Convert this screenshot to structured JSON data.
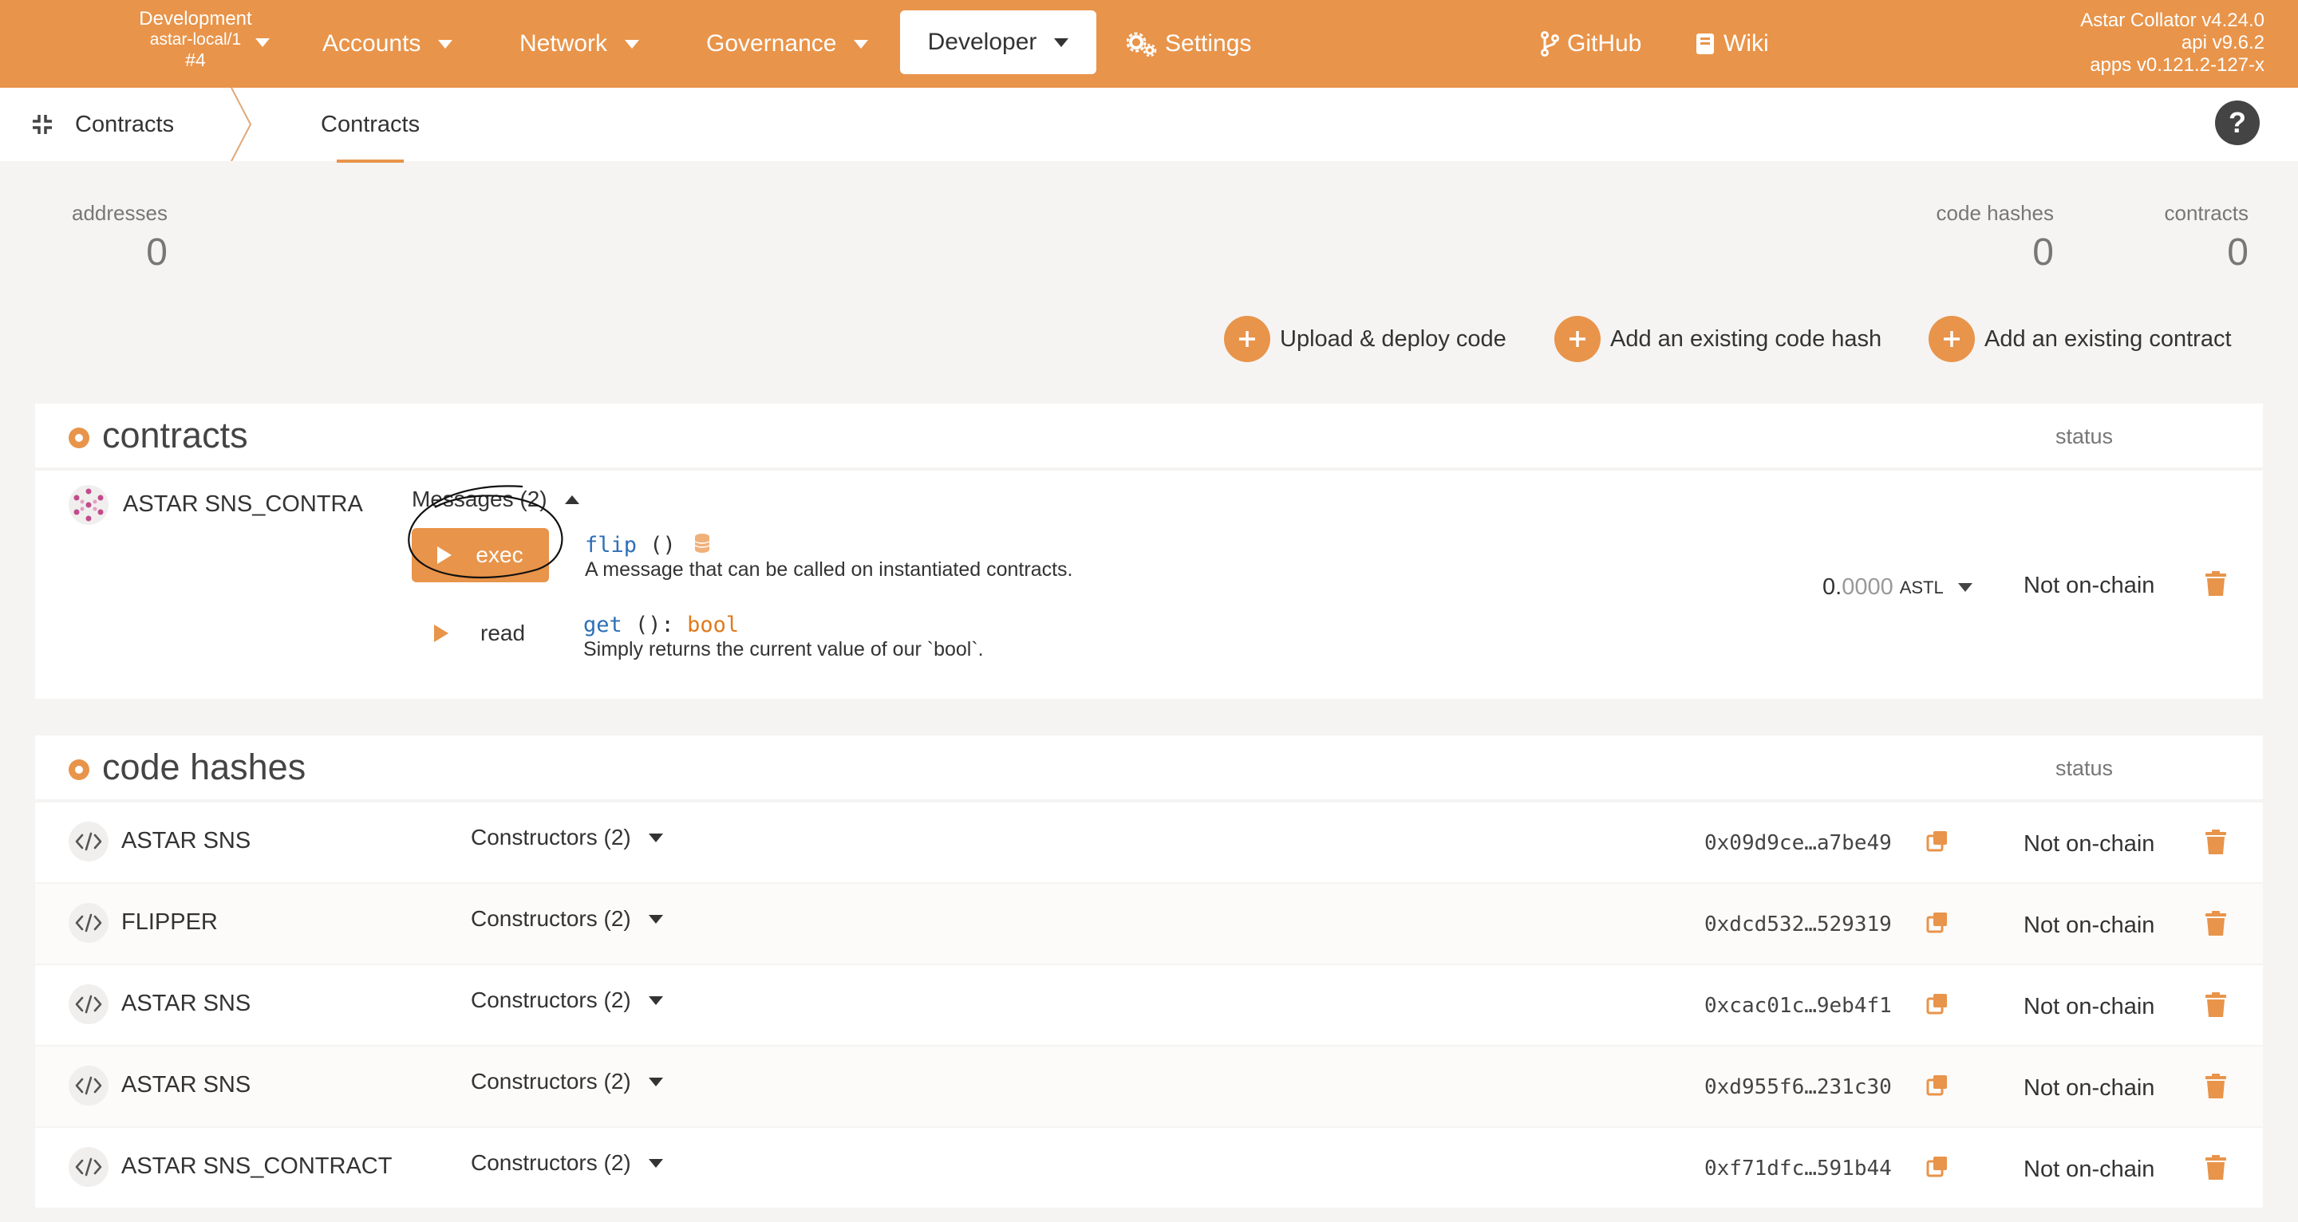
{
  "topbar": {
    "chain_line1": "Development",
    "chain_line2": "astar-local/1",
    "chain_line3": "#4",
    "nav": {
      "accounts": "Accounts",
      "network": "Network",
      "governance": "Governance",
      "developer": "Developer",
      "settings": "Settings",
      "github": "GitHub",
      "wiki": "Wiki"
    },
    "version": {
      "line1": "Astar Collator v4.24.0",
      "line2": "api v9.6.2",
      "line3": "apps v0.121.2-127-x"
    }
  },
  "subheader": {
    "section": "Contracts",
    "tab": "Contracts",
    "help": "?"
  },
  "summary": {
    "addresses_label": "addresses",
    "addresses_value": "0",
    "code_hashes_label": "code hashes",
    "code_hashes_value": "0",
    "contracts_label": "contracts",
    "contracts_value": "0"
  },
  "actions": {
    "upload": "Upload & deploy code",
    "add_code_hash": "Add an existing code hash",
    "add_contract": "Add an existing contract"
  },
  "contracts_panel": {
    "title": "contracts",
    "status_header": "status",
    "contract": {
      "name": "ASTAR SNS_CONTRA",
      "messages_label": "Messages (2)",
      "exec_label": "exec",
      "read_label": "read",
      "msg1_name": "flip",
      "msg1_sig": "()",
      "msg1_desc": "A message that can be called on instantiated contracts.",
      "msg2_name": "get",
      "msg2_sig": "():",
      "msg2_type": "bool",
      "msg2_desc": "Simply returns the current value of our `bool`.",
      "balance_int": "0.",
      "balance_dec": "0000",
      "balance_unit": "ASTL",
      "status": "Not on-chain"
    }
  },
  "code_hashes_panel": {
    "title": "code hashes",
    "status_header": "status",
    "rows": [
      {
        "name": "ASTAR SNS",
        "constructors": "Constructors (2)",
        "hash": "0x09d9ce…a7be49",
        "status": "Not on-chain"
      },
      {
        "name": "FLIPPER",
        "constructors": "Constructors (2)",
        "hash": "0xdcd532…529319",
        "status": "Not on-chain"
      },
      {
        "name": "ASTAR SNS",
        "constructors": "Constructors (2)",
        "hash": "0xcac01c…9eb4f1",
        "status": "Not on-chain"
      },
      {
        "name": "ASTAR SNS",
        "constructors": "Constructors (2)",
        "hash": "0xd955f6…231c30",
        "status": "Not on-chain"
      },
      {
        "name": "ASTAR SNS_CONTRACT",
        "constructors": "Constructors (2)",
        "hash": "0xf71dfc…591b44",
        "status": "Not on-chain"
      }
    ]
  },
  "colors": {
    "accent": "#e8944a",
    "method_blue": "#2d6fb8",
    "type_orange": "#e07a1d"
  }
}
